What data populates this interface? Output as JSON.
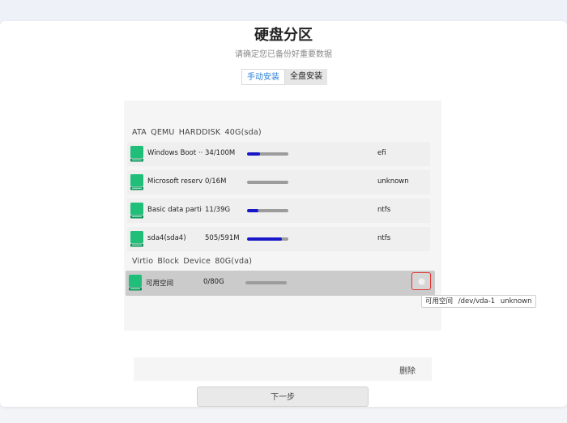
{
  "page": {
    "title": "硬盘分区",
    "subtitle": "请确定您已备份好重要数据"
  },
  "tabs": [
    {
      "label": "手动安装",
      "active": true
    },
    {
      "label": "全盘安装",
      "active": false
    }
  ],
  "devices": [
    {
      "header": "ATA QEMU HARDDISK 40G(sda)",
      "partitions": [
        {
          "name": "Windows Boot ···",
          "size": "34/100M",
          "usage": 0.32,
          "fs": "efi"
        },
        {
          "name": "Microsoft reserv···",
          "size": "0/16M",
          "usage": 0,
          "fs": "unknown"
        },
        {
          "name": "Basic data parti···",
          "size": "11/39G",
          "usage": 0.28,
          "fs": "ntfs"
        },
        {
          "name": "sda4(sda4)",
          "size": "505/591M",
          "usage": 0.85,
          "fs": "ntfs"
        }
      ]
    },
    {
      "header": "Virtio Block Device 80G(vda)",
      "partitions": [
        {
          "name": "可用空间",
          "size": "0/80G",
          "usage": 0,
          "fs": "",
          "selected": true
        }
      ]
    }
  ],
  "tooltip": "可用空间  /dev/vda-1  unknown",
  "actions": {
    "delete_label": "删除",
    "next_label": "下一步"
  },
  "colors": {
    "usage_bar": "#1717c8",
    "usage_track": "#9c9c9c",
    "selected_row": "#cbcbcb",
    "action_highlight": "#e0332f",
    "active_tab_text": "#2a7fd6",
    "disk_icon": "#1fbf7a"
  }
}
